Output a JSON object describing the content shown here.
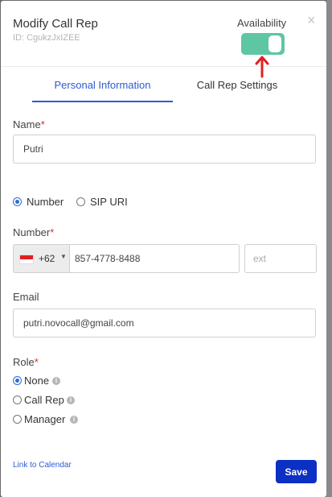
{
  "modal": {
    "title": "Modify Call Rep",
    "id_text": "ID: CgukzJxIZEE",
    "availability_label": "Availability",
    "availability_on": true,
    "close_glyph": "×"
  },
  "tabs": [
    {
      "label": "Personal Information",
      "active": true
    },
    {
      "label": "Call Rep Settings",
      "active": false
    }
  ],
  "form": {
    "name_label": "Name",
    "required_mark": "*",
    "name_value": "Putri",
    "contact_type": {
      "options": [
        "Number",
        "SIP URI"
      ],
      "selected": "Number"
    },
    "number_label": "Number",
    "country_code": "+62",
    "country_flag": "indonesia-flag",
    "number_value": "857-4778-8488",
    "ext_placeholder": "ext",
    "email_label": "Email",
    "email_value": "putri.novocall@gmail.com",
    "role_label": "Role",
    "roles": [
      "None",
      "Call Rep",
      "Manager"
    ],
    "selected_role": "None"
  },
  "footer": {
    "link_text": "Link to Calendar",
    "save_label": "Save"
  },
  "colors": {
    "accent": "#2d5bd0",
    "toggle": "#5ec6a3",
    "save": "#0c2fc4",
    "required": "#d9302c",
    "annotation_arrow": "#e02020"
  }
}
